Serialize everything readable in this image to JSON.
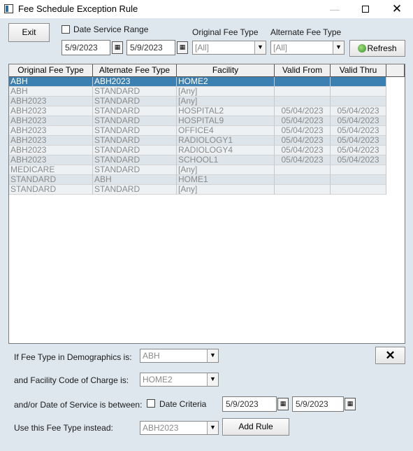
{
  "window": {
    "title": "Fee Schedule Exception Rule"
  },
  "toolbar": {
    "exit_label": "Exit",
    "date_service_range_label": "Date Service Range",
    "date_from": "5/9/2023",
    "date_to": "5/9/2023",
    "original_fee_type_label": "Original Fee Type",
    "alternate_fee_type_label": "Alternate Fee Type",
    "original_fee_type_value": "[All]",
    "alternate_fee_type_value": "[All]",
    "refresh_label": "Refresh"
  },
  "grid": {
    "columns": [
      "Original Fee Type",
      "Alternate Fee Type",
      "Facility",
      "Valid From",
      "Valid Thru"
    ],
    "rows": [
      [
        "ABH",
        "ABH2023",
        "HOME2",
        "",
        ""
      ],
      [
        "ABH",
        "STANDARD",
        "[Any]",
        "",
        ""
      ],
      [
        "ABH2023",
        "STANDARD",
        "[Any]",
        "",
        ""
      ],
      [
        "ABH2023",
        "STANDARD",
        "HOSPITAL2",
        "05/04/2023",
        "05/04/2023"
      ],
      [
        "ABH2023",
        "STANDARD",
        "HOSPITAL9",
        "05/04/2023",
        "05/04/2023"
      ],
      [
        "ABH2023",
        "STANDARD",
        "OFFICE4",
        "05/04/2023",
        "05/04/2023"
      ],
      [
        "ABH2023",
        "STANDARD",
        "RADIOLOGY1",
        "05/04/2023",
        "05/04/2023"
      ],
      [
        "ABH2023",
        "STANDARD",
        "RADIOLOGY4",
        "05/04/2023",
        "05/04/2023"
      ],
      [
        "ABH2023",
        "STANDARD",
        "SCHOOL1",
        "05/04/2023",
        "05/04/2023"
      ],
      [
        "MEDICARE",
        "STANDARD",
        "[Any]",
        "",
        ""
      ],
      [
        "STANDARD",
        "ABH",
        "HOME1",
        "",
        ""
      ],
      [
        "STANDARD",
        "STANDARD",
        "[Any]",
        "",
        ""
      ]
    ],
    "selected_row": 0
  },
  "form": {
    "fee_type_label": "If Fee Type in Demographics is:",
    "fee_type_value": "ABH",
    "facility_label": "and Facility Code of Charge is:",
    "facility_value": "HOME2",
    "date_between_label": "and/or Date of Service is between:",
    "date_criteria_label": "Date Criteria",
    "date_from": "5/9/2023",
    "date_to": "5/9/2023",
    "use_fee_type_label": "Use this Fee Type instead:",
    "use_fee_type_value": "ABH2023",
    "add_rule_label": "Add Rule",
    "delete_label": "✕"
  }
}
